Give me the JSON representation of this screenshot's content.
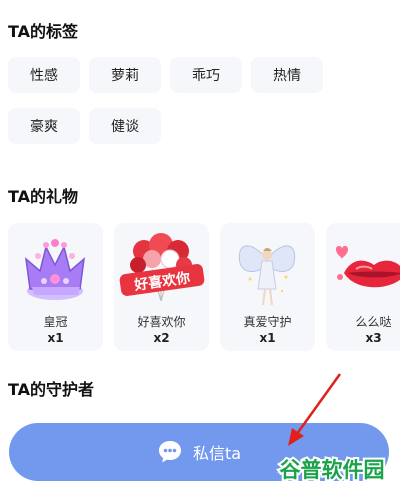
{
  "tags_section": {
    "title": "TA的标签",
    "tags": [
      "性感",
      "萝莉",
      "乖巧",
      "热情",
      "豪爽",
      "健谈"
    ]
  },
  "gifts_section": {
    "title": "TA的礼物",
    "gifts": [
      {
        "name": "皇冠",
        "count": "x1",
        "icon": "crown-gift-icon"
      },
      {
        "name": "好喜欢你",
        "count": "x2",
        "icon": "heart-balloons-gift-icon",
        "overlay": "好喜欢你"
      },
      {
        "name": "真爱守护",
        "count": "x1",
        "icon": "angel-gift-icon"
      },
      {
        "name": "么么哒",
        "count": "x3",
        "icon": "kiss-lips-gift-icon"
      }
    ]
  },
  "guardians_section": {
    "title": "TA的守护者"
  },
  "dm_button": {
    "label": "私信ta",
    "icon": "chat-bubble-icon"
  },
  "watermark": {
    "text": "谷普软件园"
  },
  "colors": {
    "accent": "#7399ef",
    "tag_bg": "#f6f7fb",
    "arrow": "#e0201b"
  }
}
